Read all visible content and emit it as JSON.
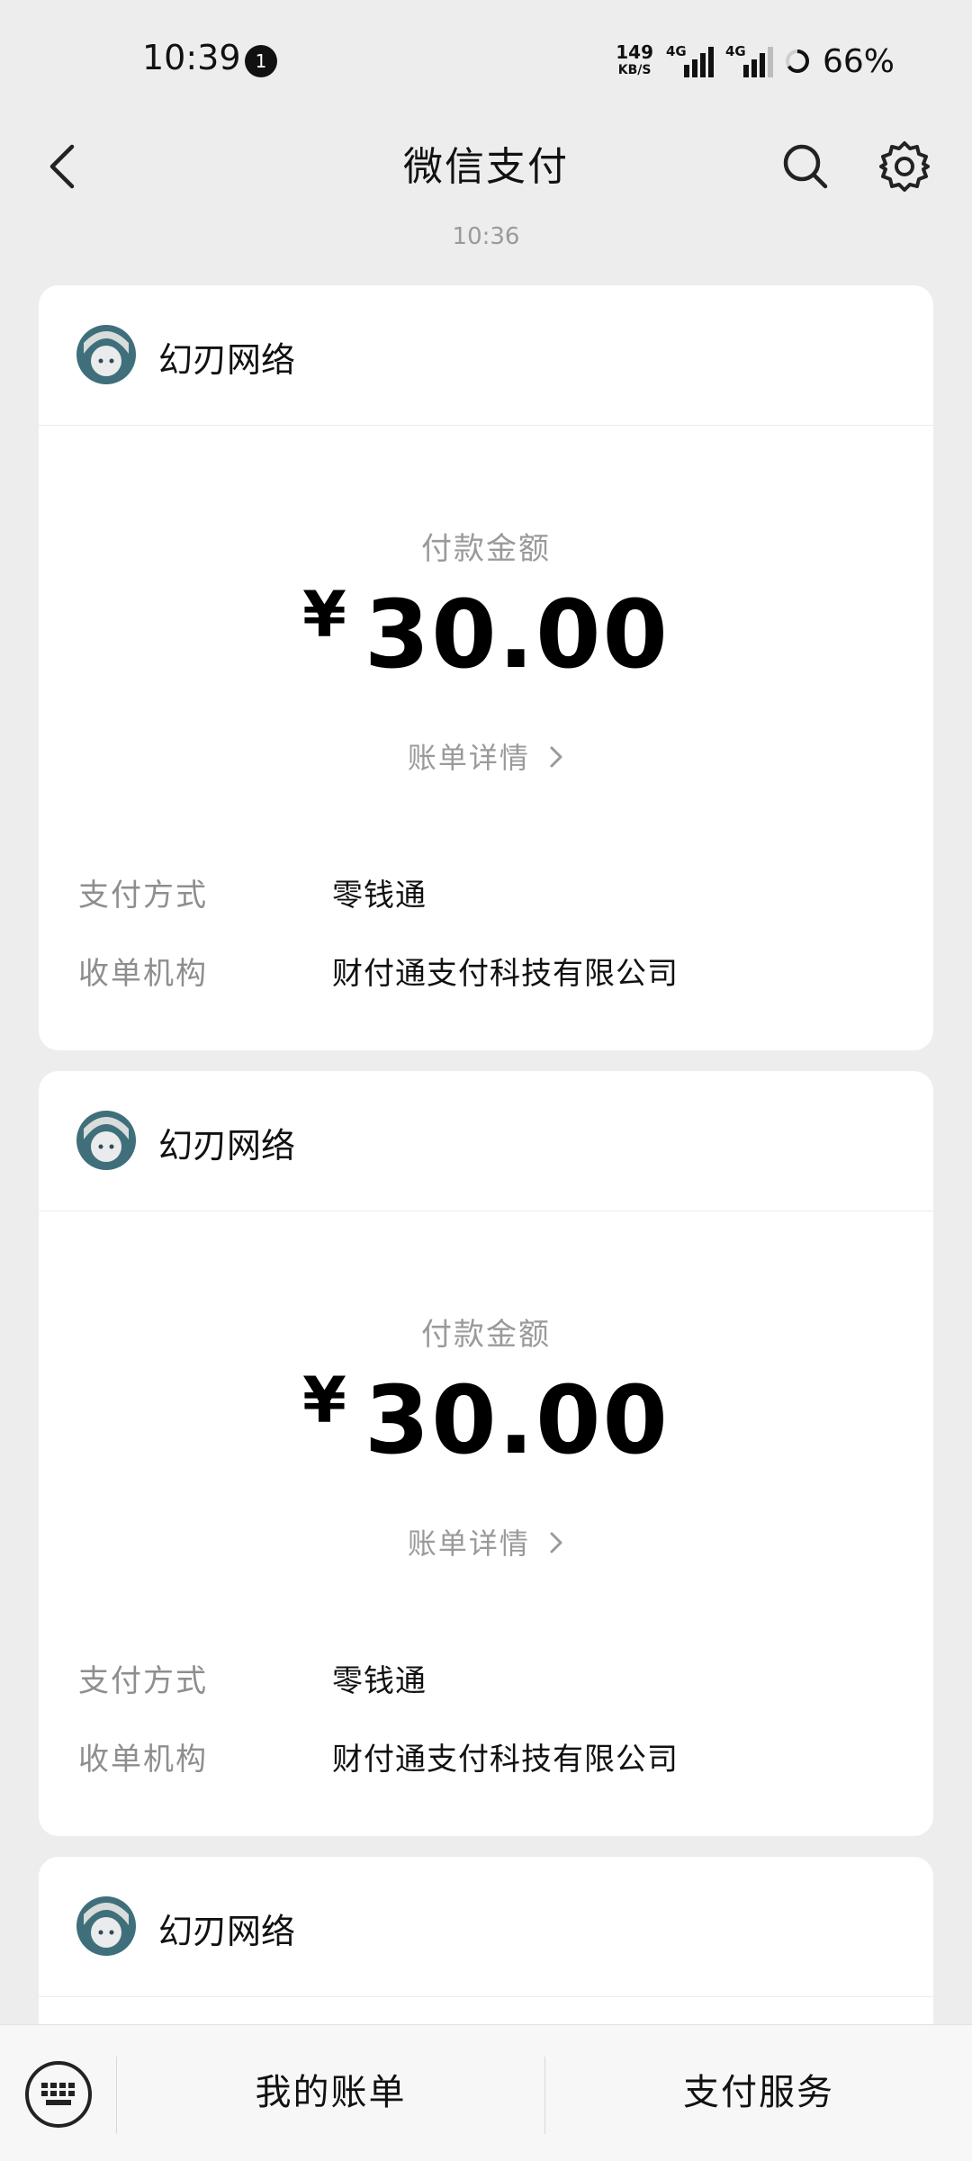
{
  "status_bar": {
    "time": "10:39",
    "notification_count": "1",
    "net_speed_value": "149",
    "net_speed_unit": "KB/S",
    "sim1_label": "4G",
    "sim2_label": "4G",
    "battery_level": 66,
    "battery_text": "66%"
  },
  "header": {
    "title": "微信支付",
    "icons": [
      "back-arrow-icon",
      "search-icon",
      "gear-icon"
    ]
  },
  "timestamp": "10:36",
  "cards": [
    {
      "merchant": "幻刃网络",
      "amount_label": "付款金额",
      "currency": "¥",
      "amount": "30.00",
      "bill_link": "账单详情",
      "rows": [
        {
          "key": "支付方式",
          "value": "零钱通"
        },
        {
          "key": "收单机构",
          "value": "财付通支付科技有限公司"
        }
      ]
    },
    {
      "merchant": "幻刃网络",
      "amount_label": "付款金额",
      "currency": "¥",
      "amount": "30.00",
      "bill_link": "账单详情",
      "rows": [
        {
          "key": "支付方式",
          "value": "零钱通"
        },
        {
          "key": "收单机构",
          "value": "财付通支付科技有限公司"
        }
      ]
    },
    {
      "merchant": "幻刃网络"
    }
  ],
  "bottom_bar": {
    "tabs": [
      "我的账单",
      "支付服务"
    ],
    "icons": [
      "keyboard-icon"
    ]
  },
  "colors": {
    "background": "#ededed",
    "card": "#ffffff",
    "secondary_text": "#9a9a9a"
  }
}
